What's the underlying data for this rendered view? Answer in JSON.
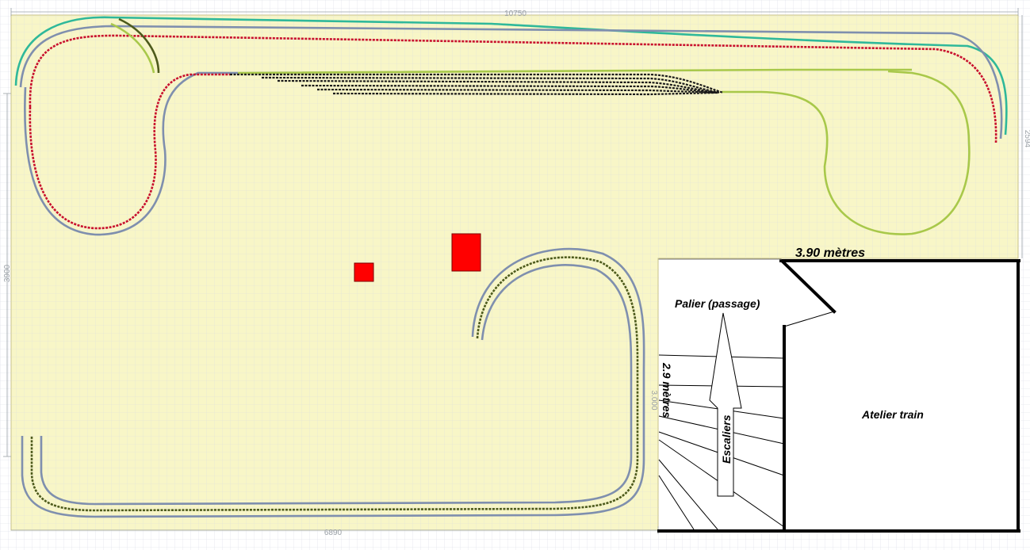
{
  "dimensions": {
    "top_length": "10750",
    "bottom_length": "6890",
    "left_height": "3900",
    "right_height": "2594",
    "stair_small": "3.000"
  },
  "labels": {
    "width_top": "3.90 mètres",
    "landing": "Palier (passage)",
    "stair_length": "2.9 mètres",
    "stairs": "Escaliers",
    "workshop": "Atelier train"
  },
  "colors": {
    "layout_board": "#f7f4bd",
    "grid": "#d8dce6",
    "track_red": "#c8102e",
    "track_teal": "#2fb89a",
    "track_blue_gray": "#7f8fae",
    "track_olive": "#4d5a1c",
    "track_yellow_green": "#a8c84a",
    "yard_black": "#1a1a1a",
    "obstacle": "#ff0000"
  }
}
